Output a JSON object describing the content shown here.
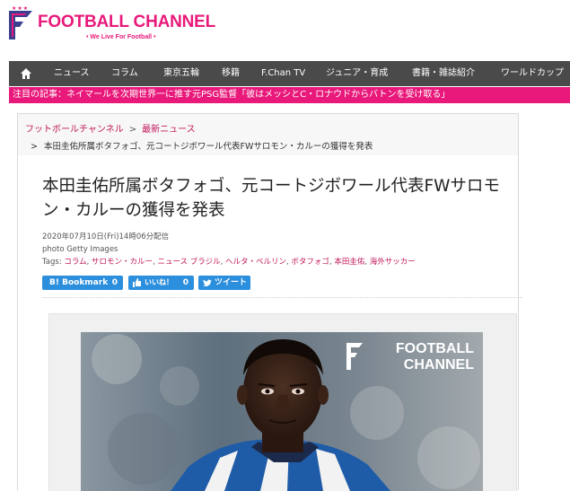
{
  "brand": {
    "name": "FOOTBALL CHANNEL",
    "tagline": "• We Live For Football •",
    "color": "#e8197a"
  },
  "nav": {
    "items": [
      "ニュース",
      "コラム",
      "東京五輪",
      "移籍",
      "F.Chan TV",
      "ジュニア・育成",
      "書籍・雑誌紹介",
      "ワールドカップ"
    ]
  },
  "notice": {
    "label": "注目の記事：",
    "text": "ネイマールを次期世界一に推す元PSG監督「彼はメッシとC・ロナウドからバトンを受け取る」"
  },
  "breadcrumb": {
    "home": "フットボールチャンネル",
    "section": "最新ニュース",
    "current": "本田圭佑所属ボタフォゴ、元コートジボワール代表FWサロモン・カルーの獲得を発表"
  },
  "article": {
    "title": "本田圭佑所属ボタフォゴ、元コートジボワール代表FWサロモン・カルーの獲得を発表",
    "date": "2020年07月10日(Fri)14時06分配信",
    "photo_credit": "photo Getty Images",
    "tags_label": "Tags:",
    "tags": [
      "コラム",
      "サロモン・カルー",
      "ニュース",
      "ブラジル",
      "ヘルタ・ベルリン",
      "ボタフォゴ",
      "本田圭佑",
      "海外サッカー"
    ]
  },
  "share": {
    "bookmark_label": "B! Bookmark",
    "bookmark_count": "0",
    "like_label": "いいね！",
    "like_count": "0",
    "tweet_label": "ツイート"
  },
  "photo_watermark": {
    "line1": "FOOTBALL",
    "line2": "CHANNEL"
  }
}
